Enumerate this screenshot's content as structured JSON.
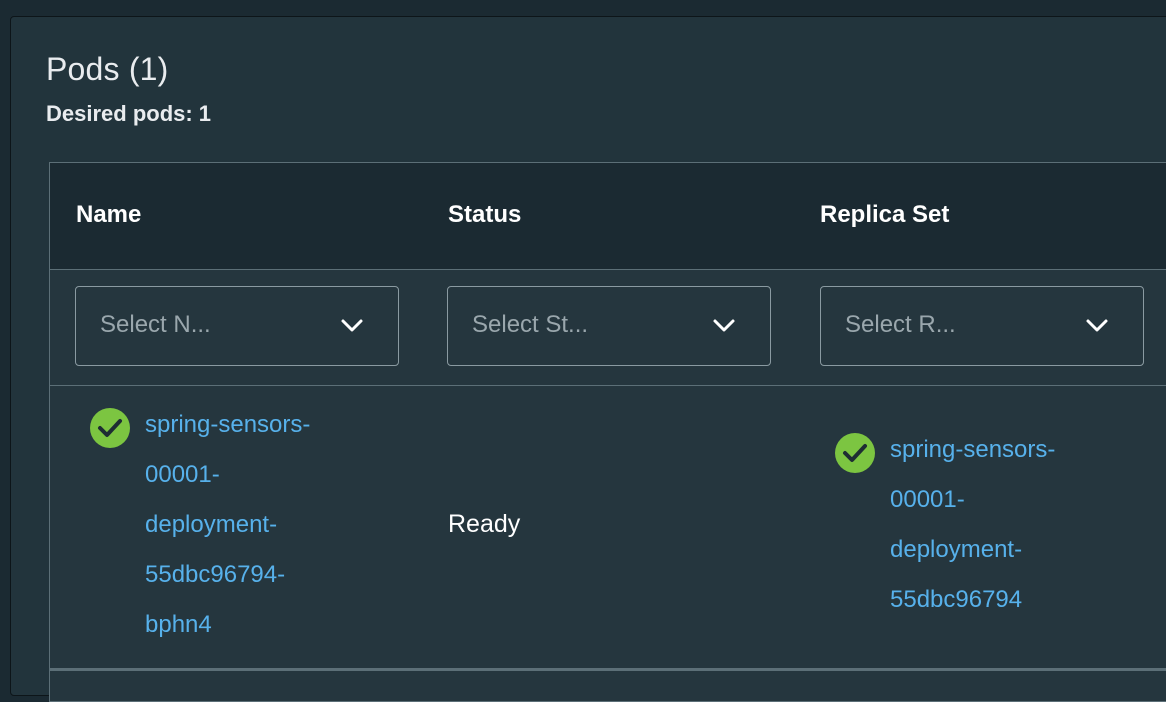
{
  "panel": {
    "title": "Pods (1)",
    "desired": "Desired pods: 1"
  },
  "table": {
    "columns": [
      {
        "label": "Name",
        "filter_placeholder": "Select N..."
      },
      {
        "label": "Status",
        "filter_placeholder": "Select St..."
      },
      {
        "label": "Replica Set",
        "filter_placeholder": "Select R..."
      }
    ],
    "rows": [
      {
        "status_icon": "check-circle-icon",
        "name_lines": [
          "spring-sensors-",
          "00001-",
          "deployment-",
          "55dbc96794-",
          "bphn4"
        ],
        "status": "Ready",
        "replica_icon": "check-circle-icon",
        "replica_lines": [
          "spring-sensors-",
          "00001-",
          "deployment-",
          "55dbc96794"
        ]
      }
    ]
  },
  "colors": {
    "background": "#1b2a32",
    "panel": "#22343c",
    "link": "#57b1eb",
    "success": "#7cc541"
  }
}
